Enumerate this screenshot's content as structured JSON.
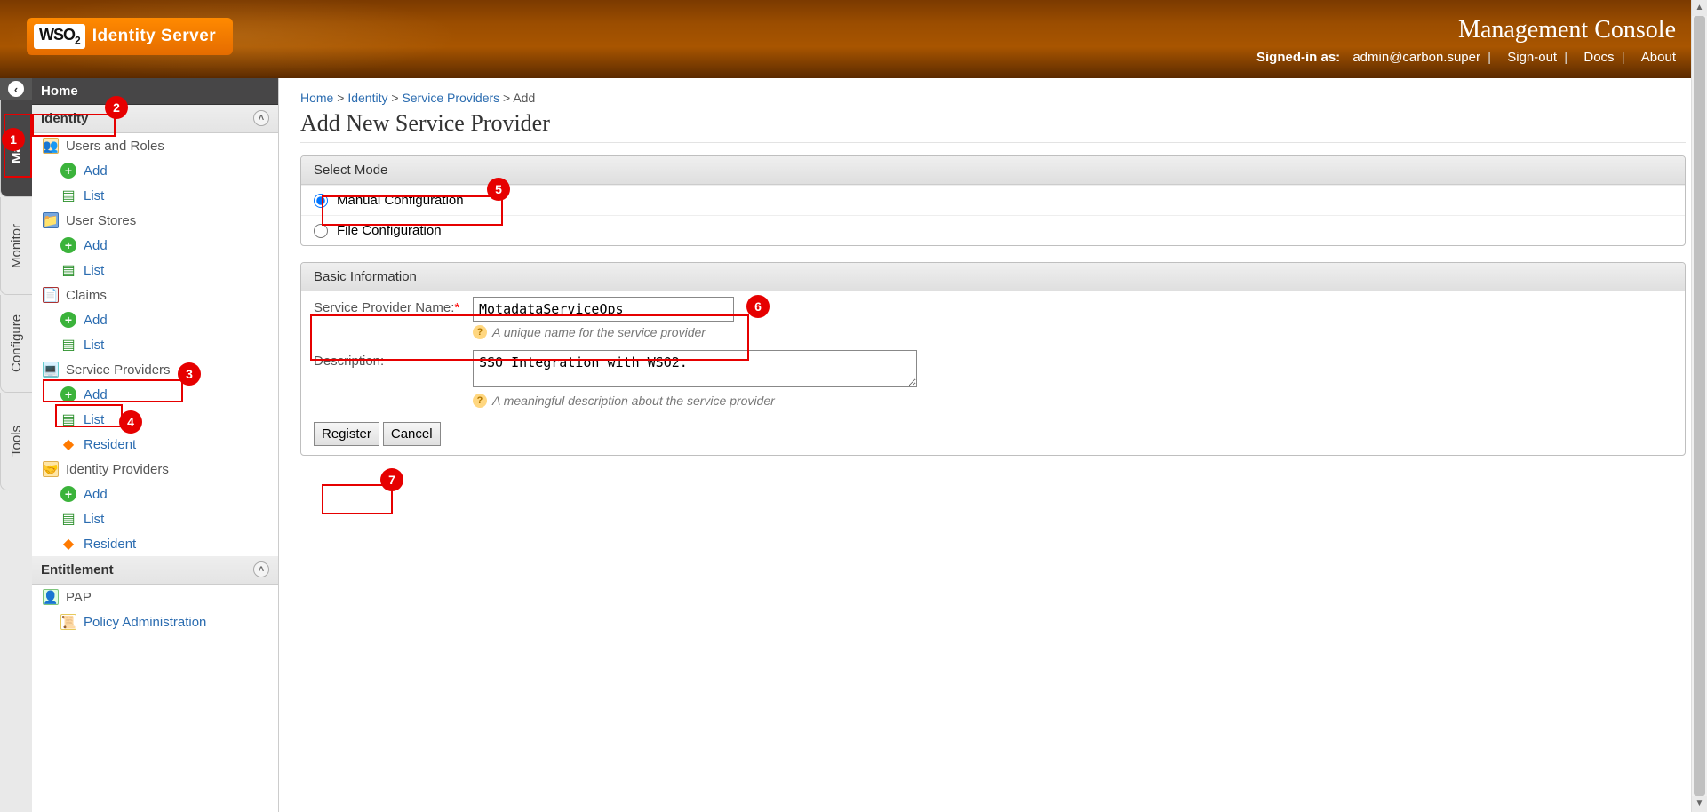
{
  "header": {
    "logo_main": "WSO",
    "logo_sub": "2",
    "logo_text": "Identity Server",
    "console_title": "Management Console",
    "signed_in_label": "Signed-in as:",
    "signed_in_user": "admin@carbon.super",
    "signout": "Sign-out",
    "docs": "Docs",
    "about": "About"
  },
  "sidetabs": [
    "Main",
    "Monitor",
    "Configure",
    "Tools"
  ],
  "nav": {
    "home": "Home",
    "sections": {
      "identity": "Identity",
      "entitlement": "Entitlement"
    },
    "items": {
      "users_roles": "Users and Roles",
      "user_stores": "User Stores",
      "claims": "Claims",
      "service_providers": "Service Providers",
      "identity_providers": "Identity Providers",
      "pap": "PAP",
      "policy_admin": "Policy Administration"
    },
    "subs": {
      "add": "Add",
      "list": "List",
      "resident": "Resident"
    }
  },
  "breadcrumb": [
    "Home",
    "Identity",
    "Service Providers",
    "Add"
  ],
  "page_title": "Add New Service Provider",
  "panel_mode": {
    "title": "Select Mode",
    "manual": "Manual Configuration",
    "file": "File Configuration"
  },
  "panel_basic": {
    "title": "Basic Information",
    "sp_name_label": "Service Provider Name:",
    "sp_name_value": "MotadataServiceOps",
    "sp_name_help": "A unique name for the service provider",
    "desc_label": "Description:",
    "desc_value": "SSO Integration with WSO2.",
    "desc_help": "A meaningful description about the service provider"
  },
  "buttons": {
    "register": "Register",
    "cancel": "Cancel"
  },
  "callouts": [
    "1",
    "2",
    "3",
    "4",
    "5",
    "6",
    "7"
  ]
}
